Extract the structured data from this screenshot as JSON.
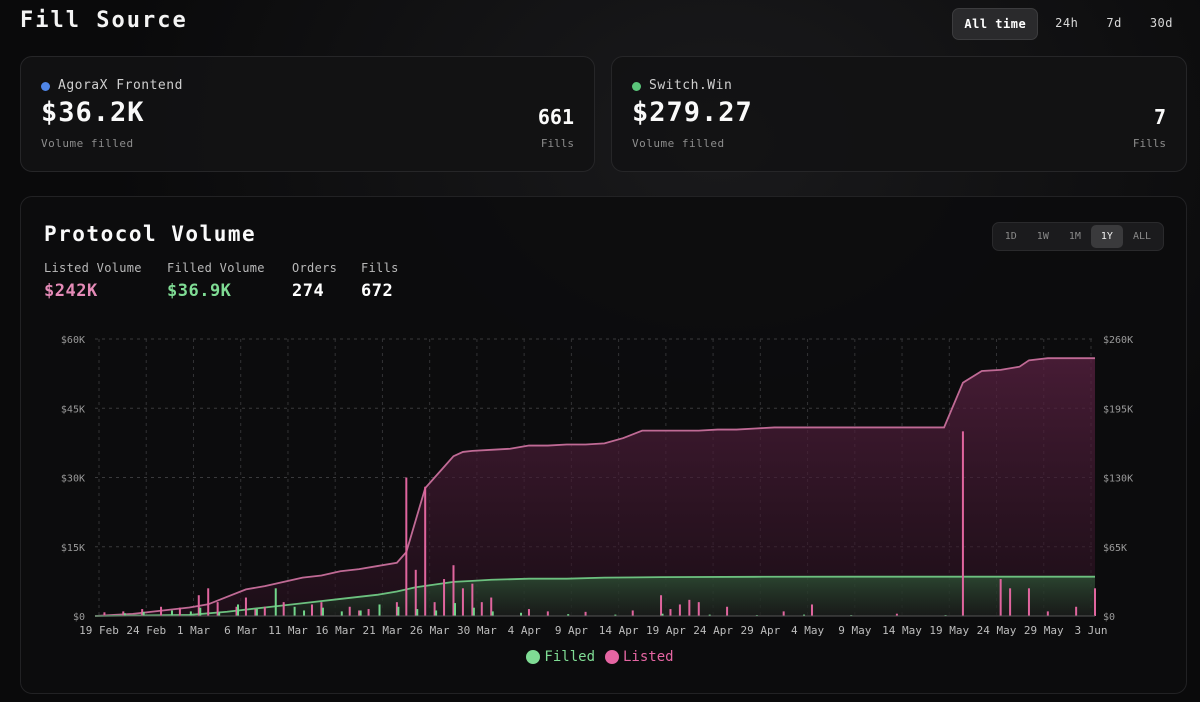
{
  "header": {
    "title": "Fill Source",
    "range_tabs": [
      "All time",
      "24h",
      "7d",
      "30d"
    ],
    "active_range": "All time"
  },
  "sources": [
    {
      "name": "AgoraX Frontend",
      "dot_color": "#4f86e8",
      "amount": "$36.2K",
      "amount_label": "Volume filled",
      "fills": "661",
      "fills_label": "Fills"
    },
    {
      "name": "Switch.Win",
      "dot_color": "#5ac57a",
      "amount": "$279.27",
      "amount_label": "Volume filled",
      "fills": "7",
      "fills_label": "Fills"
    }
  ],
  "protocol": {
    "title": "Protocol Volume",
    "resolution_tabs": [
      "1D",
      "1W",
      "1M",
      "1Y",
      "ALL"
    ],
    "active_resolution": "1Y",
    "stats": [
      {
        "label": "Listed Volume",
        "value": "$242K",
        "color": "#e58bb7"
      },
      {
        "label": "Filled Volume",
        "value": "$36.9K",
        "color": "#7fdc94"
      },
      {
        "label": "Orders",
        "value": "274",
        "color": "#ffffff"
      },
      {
        "label": "Fills",
        "value": "672",
        "color": "#ffffff"
      }
    ]
  },
  "chart_data": {
    "type": "area",
    "colors": {
      "filled": "#72d68b",
      "listed": "#e0659e"
    },
    "x_ticks": [
      "19 Feb",
      "24 Feb",
      "1 Mar",
      "6 Mar",
      "11 Mar",
      "16 Mar",
      "21 Mar",
      "26 Mar",
      "30 Mar",
      "4 Apr",
      "9 Apr",
      "14 Apr",
      "19 Apr",
      "24 Apr",
      "29 Apr",
      "4 May",
      "9 May",
      "14 May",
      "19 May",
      "24 May",
      "29 May",
      "3 Jun"
    ],
    "y_left_ticks": [
      "$0",
      "$15K",
      "$30K",
      "$45K",
      "$60K"
    ],
    "y_right_ticks": [
      "$0",
      "$65K",
      "$130K",
      "$195K",
      "$260K"
    ],
    "ylim_left": [
      0,
      60000
    ],
    "ylim_right": [
      0,
      260000
    ],
    "x_range_days": [
      0,
      106
    ],
    "grid": true,
    "legend": [
      "Filled",
      "Listed"
    ],
    "legend_position": "bottom-center",
    "series": [
      {
        "name": "Listed",
        "axis": "right",
        "kind": "cumulative",
        "x": [
          0,
          2,
          4,
          6,
          8,
          10,
          12,
          14,
          16,
          18,
          20,
          22,
          24,
          26,
          28,
          30,
          32,
          33,
          34,
          35,
          36,
          37,
          38,
          39,
          40,
          42,
          44,
          46,
          48,
          50,
          52,
          54,
          56,
          58,
          60,
          62,
          64,
          66,
          68,
          70,
          72,
          74,
          76,
          78,
          80,
          82,
          84,
          86,
          88,
          90,
          92,
          94,
          96,
          98,
          99,
          100,
          101,
          102,
          104,
          106
        ],
        "values": [
          0,
          1000,
          2000,
          4000,
          6000,
          8000,
          11000,
          18000,
          25000,
          28000,
          32000,
          36000,
          38000,
          42000,
          44000,
          47000,
          50000,
          60000,
          90000,
          120000,
          130000,
          140000,
          150000,
          154000,
          155000,
          156000,
          157000,
          160000,
          160000,
          161000,
          161000,
          162000,
          167000,
          174000,
          174000,
          174000,
          174000,
          175000,
          175000,
          176000,
          177000,
          177000,
          177000,
          177000,
          177000,
          177000,
          177000,
          177000,
          177000,
          177000,
          219000,
          230000,
          231000,
          234000,
          240000,
          241000,
          242000,
          242000,
          242000,
          242000
        ]
      },
      {
        "name": "Filled",
        "axis": "right",
        "kind": "cumulative",
        "x": [
          0,
          10,
          14,
          18,
          22,
          26,
          30,
          32,
          34,
          38,
          40,
          42,
          46,
          50,
          54,
          60,
          70,
          80,
          90,
          106
        ],
        "values": [
          0,
          1000,
          4000,
          8000,
          12000,
          16000,
          20000,
          23000,
          27000,
          32000,
          33000,
          34000,
          35000,
          35000,
          36000,
          36500,
          36800,
          36900,
          36900,
          36900
        ]
      },
      {
        "name": "Listed",
        "axis": "left",
        "kind": "daily_bars",
        "x": [
          1,
          3,
          5,
          7,
          9,
          11,
          12,
          13,
          15,
          16,
          17,
          18,
          20,
          23,
          24,
          27,
          28,
          29,
          32,
          33,
          34,
          35,
          36,
          37,
          38,
          39,
          40,
          41,
          42,
          46,
          48,
          52,
          57,
          60,
          61,
          62,
          63,
          64,
          67,
          73,
          76,
          85,
          92,
          96,
          97,
          99,
          101,
          104,
          106
        ],
        "values": [
          800,
          1000,
          1500,
          2000,
          1800,
          4500,
          6000,
          3000,
          2000,
          4000,
          1500,
          2000,
          3000,
          2500,
          3000,
          2000,
          1200,
          1500,
          3000,
          30000,
          10000,
          28000,
          3000,
          8000,
          11000,
          6000,
          7000,
          3000,
          4000,
          1500,
          1000,
          900,
          1200,
          4500,
          1500,
          2500,
          3500,
          3000,
          2000,
          1000,
          2500,
          500,
          40000,
          8000,
          6000,
          6000,
          1000,
          2000,
          6000
        ]
      },
      {
        "name": "Filled",
        "axis": "left",
        "kind": "daily_bars",
        "x": [
          3,
          5,
          8,
          10,
          11,
          13,
          15,
          17,
          19,
          21,
          22,
          24,
          26,
          28,
          30,
          32,
          34,
          36,
          38,
          40,
          42,
          45,
          50,
          55,
          60,
          65,
          70,
          75,
          80,
          90
        ],
        "values": [
          600,
          900,
          1200,
          1000,
          1800,
          800,
          2500,
          1500,
          6000,
          2000,
          1200,
          1800,
          1000,
          1200,
          2500,
          2000,
          1500,
          1200,
          2800,
          1800,
          1000,
          700,
          400,
          300,
          500,
          300,
          200,
          300,
          200,
          200
        ]
      }
    ]
  }
}
